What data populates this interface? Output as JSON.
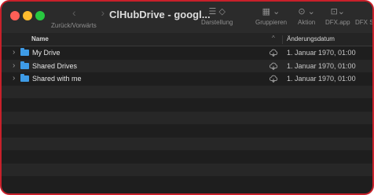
{
  "window": {
    "title": "ClHubDrive - googl...",
    "nav_label": "Zurück/Vorwärts",
    "nav_arrows": "‹ ›"
  },
  "toolbar": {
    "view": {
      "icon": "☰ ◇",
      "label": "Darstellung"
    },
    "group": {
      "icon": "▦ ⌄",
      "label": "Gruppieren"
    },
    "action": {
      "icon": "⊙ ⌄",
      "label": "Aktion"
    },
    "dfx_app": {
      "icon": "⊡⌄",
      "label": "DFX.app"
    },
    "dfx_sc": {
      "icon": "",
      "label": "DFX Sc"
    }
  },
  "columns": {
    "name": "Name",
    "sort_indicator": "^",
    "date_modified": "Änderungsdatum"
  },
  "files": [
    {
      "name": "My Drive",
      "date": "1. Januar 1970, 01:00",
      "icon": "folder-icon",
      "status": "cloud-icon"
    },
    {
      "name": "Shared Drives",
      "date": "1. Januar 1970, 01:00",
      "icon": "folder-icon",
      "status": "cloud-icon"
    },
    {
      "name": "Shared with me",
      "date": "1. Januar 1970, 01:00",
      "icon": "folder-icon",
      "status": "cloud-icon"
    }
  ],
  "colors": {
    "folder": "#3e9be6",
    "window_border": "#c8202a",
    "background": "#1e1e1e"
  }
}
